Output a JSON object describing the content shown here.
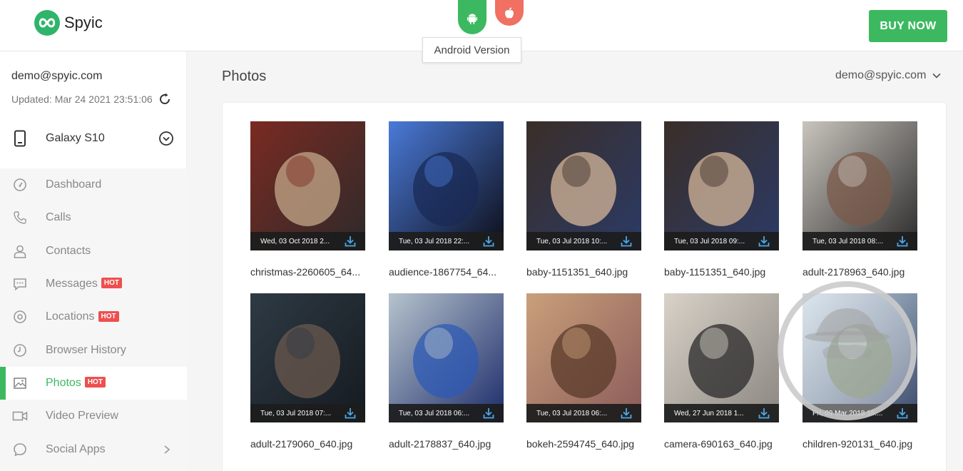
{
  "header": {
    "brand": "Spyic",
    "tooltip": "Android Version",
    "buy_label": "BUY NOW"
  },
  "account": {
    "email": "demo@spyic.com",
    "updated": "Updated: Mar 24 2021 23:51:06"
  },
  "device": {
    "name": "Galaxy S10"
  },
  "nav": [
    {
      "label": "Dashboard",
      "icon": "dashboard-icon"
    },
    {
      "label": "Calls",
      "icon": "phone-icon"
    },
    {
      "label": "Contacts",
      "icon": "contacts-icon"
    },
    {
      "label": "Messages",
      "icon": "messages-icon",
      "badge": "HOT"
    },
    {
      "label": "Locations",
      "icon": "location-icon",
      "badge": "HOT"
    },
    {
      "label": "Browser History",
      "icon": "clock-icon"
    },
    {
      "label": "Photos",
      "icon": "photo-icon",
      "badge": "HOT",
      "active": true
    },
    {
      "label": "Video Preview",
      "icon": "video-icon"
    },
    {
      "label": "Social Apps",
      "icon": "chat-icon"
    }
  ],
  "main": {
    "title": "Photos",
    "user_menu": "demo@spyic.com"
  },
  "photos": [
    {
      "date": "Wed, 03 Oct 2018 2...",
      "name": "christmas-2260605_64...",
      "colors": [
        "#7a2a22",
        "#c4a88a",
        "#2d2a2a"
      ]
    },
    {
      "date": "Tue, 03 Jul 2018 22:...",
      "name": "audience-1867754_64...",
      "colors": [
        "#4a7ad8",
        "#1a2a55",
        "#0d0d16"
      ]
    },
    {
      "date": "Tue, 03 Jul 2018 10:...",
      "name": "baby-1151351_640.jpg",
      "colors": [
        "#3a2e28",
        "#d6b79a",
        "#2b3a66"
      ]
    },
    {
      "date": "Tue, 03 Jul 2018 09:...",
      "name": "baby-1151351_640.jpg",
      "colors": [
        "#3a2e28",
        "#d6b79a",
        "#2b3a66"
      ]
    },
    {
      "date": "Tue, 03 Jul 2018 08:...",
      "name": "adult-2178963_640.jpg",
      "colors": [
        "#c9c4bd",
        "#7a5a4a",
        "#2a2a2a"
      ]
    },
    {
      "date": "Tue, 03 Jul 2018 07:...",
      "name": "adult-2179060_640.jpg",
      "colors": [
        "#2e3a44",
        "#6b5a4d",
        "#151a20"
      ]
    },
    {
      "date": "Tue, 03 Jul 2018 06:...",
      "name": "adult-2178837_640.jpg",
      "colors": [
        "#b6c3cd",
        "#2d5ab4",
        "#1c2b6a"
      ]
    },
    {
      "date": "Tue, 03 Jul 2018 06:...",
      "name": "bokeh-2594745_640.jpg",
      "colors": [
        "#c9a07a",
        "#5a3a2a",
        "#8a5a5a"
      ]
    },
    {
      "date": "Wed, 27 Jun 2018 1...",
      "name": "camera-690163_640.jpg",
      "colors": [
        "#d8d2c8",
        "#2a2a2a",
        "#8a8580"
      ]
    },
    {
      "date": "Fri, 09 Mar 2018 15:...",
      "name": "children-920131_640.jpg",
      "colors": [
        "#c8d8e4",
        "#6a7a5a",
        "#3a4a6a"
      ]
    }
  ],
  "colors": {
    "brand_green": "#3cb960",
    "apple_red": "#f07062",
    "hot_red": "#ef4f4f",
    "download_blue": "#4aa8e8"
  }
}
